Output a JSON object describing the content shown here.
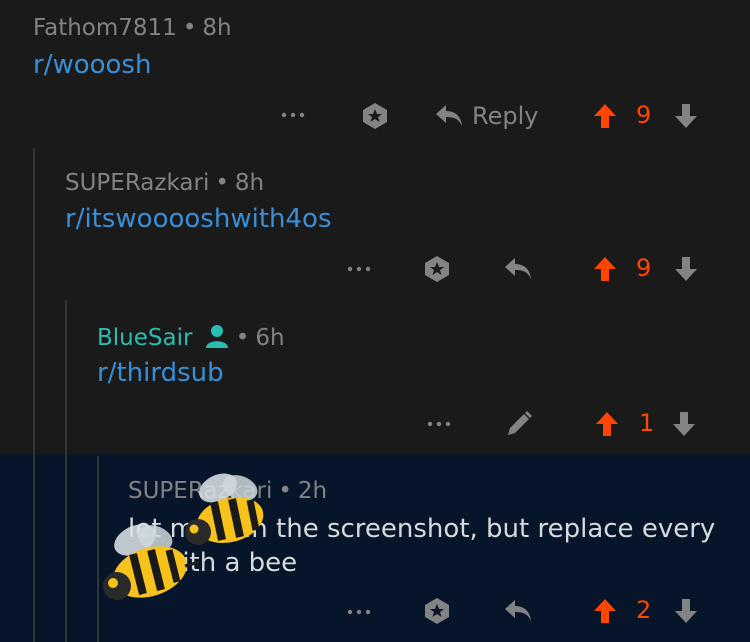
{
  "comments": [
    {
      "author": "Fathom7811",
      "time": "8h",
      "body": "r/wooosh",
      "score": "9",
      "reply_label": "Reply"
    },
    {
      "author": "SUPERazkari",
      "time": "8h",
      "body": "r/itswooooshwith4os",
      "score": "9"
    },
    {
      "author": "BlueSair",
      "time": "6h",
      "body": "r/thirdsub",
      "score": "1"
    },
    {
      "author": "SUPERazkari",
      "time": "2h",
      "body": "let me... in the screenshot, but replace every ... with a bee",
      "score": "2"
    }
  ],
  "separator": "•",
  "colors": {
    "background": "#1a1a1b",
    "highlight": "#061529",
    "link": "#3a8ed6",
    "upvote": "#ff4500",
    "op": "#2bbdb0",
    "muted": "#818384"
  },
  "icons": [
    "more-icon",
    "award-icon",
    "reply-icon",
    "upvote-icon",
    "downvote-icon",
    "edit-icon",
    "user-icon",
    "bee-icon"
  ]
}
